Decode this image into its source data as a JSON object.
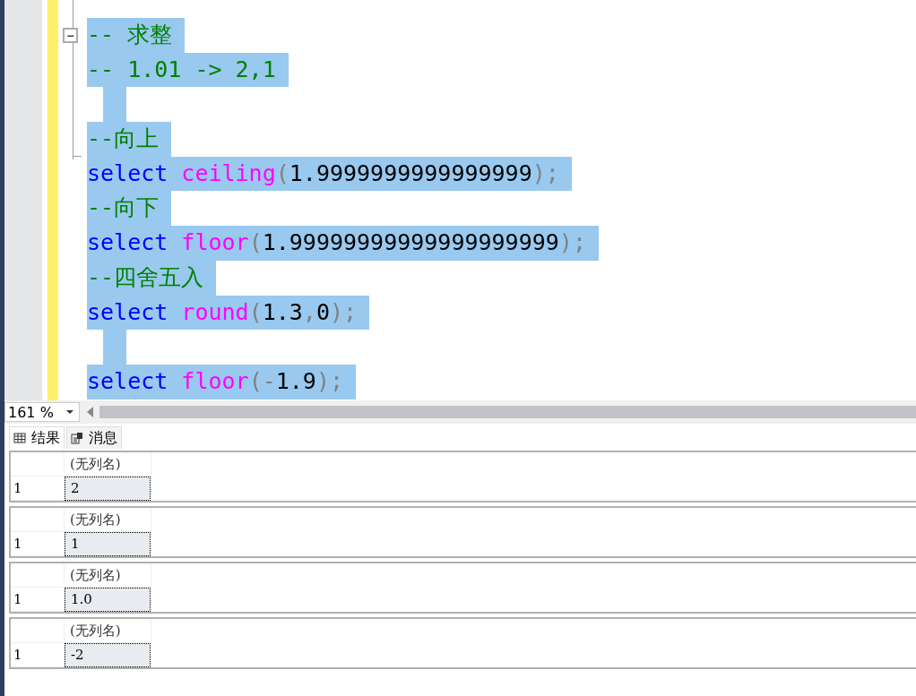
{
  "editor": {
    "lines": [
      {
        "selected": true,
        "tokens": [
          {
            "kind": "comment",
            "text": "-- 求整"
          }
        ]
      },
      {
        "selected": true,
        "tokens": [
          {
            "kind": "comment",
            "text": "-- 1.01 -> 2,1"
          }
        ]
      },
      {
        "selected": true
      },
      {
        "selected": true,
        "tokens": [
          {
            "kind": "comment",
            "text": "--向上"
          }
        ]
      },
      {
        "selected": true,
        "tokens": [
          {
            "kind": "keyword",
            "text": "select"
          },
          {
            "kind": "function",
            "text": "ceiling"
          },
          {
            "kind": "punct",
            "text": "("
          },
          {
            "kind": "number",
            "text": "1.9999999999999999"
          },
          {
            "kind": "punct",
            "text": ");"
          }
        ]
      },
      {
        "selected": true,
        "tokens": [
          {
            "kind": "comment",
            "text": "--向下"
          }
        ]
      },
      {
        "selected": true,
        "tokens": [
          {
            "kind": "keyword",
            "text": "select"
          },
          {
            "kind": "function",
            "text": "floor"
          },
          {
            "kind": "punct",
            "text": "("
          },
          {
            "kind": "number",
            "text": "1.99999999999999999999"
          },
          {
            "kind": "punct",
            "text": ");"
          }
        ]
      },
      {
        "selected": true,
        "tokens": [
          {
            "kind": "comment",
            "text": "--四舍五入"
          }
        ]
      },
      {
        "selected": true,
        "tokens": [
          {
            "kind": "keyword",
            "text": "select"
          },
          {
            "kind": "function",
            "text": "round"
          },
          {
            "kind": "punct",
            "text": "("
          },
          {
            "kind": "number",
            "text": "1.3"
          },
          {
            "kind": "punct",
            "text": ","
          },
          {
            "kind": "number",
            "text": "0"
          },
          {
            "kind": "punct",
            "text": ");"
          }
        ]
      },
      {
        "selected": true
      },
      {
        "selected": true,
        "tokens": [
          {
            "kind": "keyword",
            "text": "select"
          },
          {
            "kind": "function",
            "text": "floor"
          },
          {
            "kind": "punct",
            "text": "("
          },
          {
            "kind": "punct",
            "text": "-"
          },
          {
            "kind": "number",
            "text": "1.9"
          },
          {
            "kind": "punct",
            "text": ");"
          }
        ]
      }
    ],
    "collapse_toggle": "−"
  },
  "zoom": {
    "value": "161 %"
  },
  "tabs": [
    {
      "label": "结果",
      "selected": true
    },
    {
      "label": "消息",
      "selected": false
    }
  ],
  "results": [
    {
      "column": "(无列名)",
      "row_number": "1",
      "value": "2",
      "selected": true
    },
    {
      "column": "(无列名)",
      "row_number": "1",
      "value": "1",
      "selected": true
    },
    {
      "column": "(无列名)",
      "row_number": "1",
      "value": "1.0",
      "selected": true
    },
    {
      "column": "(无列名)",
      "row_number": "1",
      "value": "-2",
      "selected": true
    }
  ]
}
